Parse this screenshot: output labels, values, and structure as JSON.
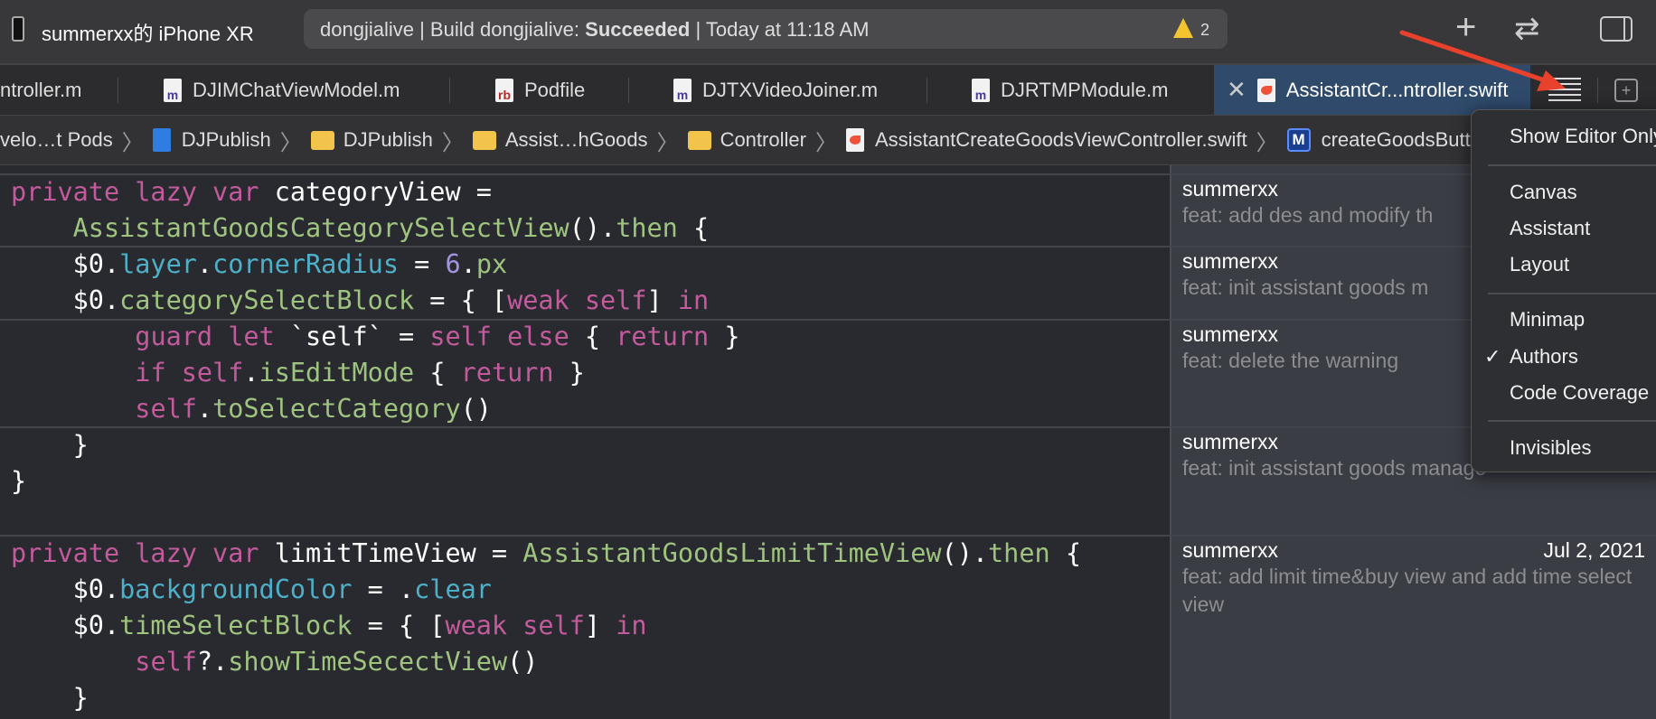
{
  "toolbar": {
    "device": "summerxx的 iPhone XR",
    "status_project": "dongjialive",
    "status_prefix": "Build dongjialive: ",
    "status_result": "Succeeded",
    "status_time": "Today at 11:18 AM",
    "warning_count": "2",
    "add_label": "+",
    "swap_label": "⇄"
  },
  "tabs": [
    {
      "label": "ntroller.m",
      "icon": "m"
    },
    {
      "label": "DJIMChatViewModel.m",
      "icon": "m"
    },
    {
      "label": "Podfile",
      "icon": "rb"
    },
    {
      "label": "DJTXVideoJoiner.m",
      "icon": "m"
    },
    {
      "label": "DJRTMPModule.m",
      "icon": "m"
    },
    {
      "label": "AssistantCr...ntroller.swift",
      "icon": "swift",
      "active": true
    }
  ],
  "breadcrumb": [
    "velo…t Pods",
    "DJPublish",
    "DJPublish",
    "Assist…hGoods",
    "Controller",
    "AssistantCreateGoodsViewController.swift",
    "createGoodsButto"
  ],
  "breadcrumb_method_icon": "M",
  "code": [
    [
      [
        "private lazy var ",
        "kw"
      ],
      [
        "categoryView =",
        "pl"
      ]
    ],
    [
      [
        "    ",
        "pl"
      ],
      [
        "AssistantGoodsCategorySelectView",
        "ty"
      ],
      [
        "().",
        "pl"
      ],
      [
        "then",
        "ty"
      ],
      [
        " {",
        "pl"
      ]
    ],
    [
      [
        "    $0.",
        "pl"
      ],
      [
        "layer",
        "pr"
      ],
      [
        ".",
        "pl"
      ],
      [
        "cornerRadius",
        "pr"
      ],
      [
        " = ",
        "pl"
      ],
      [
        "6",
        "nm"
      ],
      [
        ".",
        "pl"
      ],
      [
        "px",
        "ty"
      ]
    ],
    [
      [
        "    $0.",
        "pl"
      ],
      [
        "categorySelectBlock",
        "ty"
      ],
      [
        " = { [",
        "pl"
      ],
      [
        "weak self",
        "kw"
      ],
      [
        "] ",
        "pl"
      ],
      [
        "in",
        "kw"
      ]
    ],
    [
      [
        "        ",
        "pl"
      ],
      [
        "guard let",
        "kw"
      ],
      [
        " `self` = ",
        "pl"
      ],
      [
        "self else",
        "kw"
      ],
      [
        " { ",
        "pl"
      ],
      [
        "return",
        "kw"
      ],
      [
        " }",
        "pl"
      ]
    ],
    [
      [
        "        ",
        "pl"
      ],
      [
        "if self",
        "kw"
      ],
      [
        ".",
        "pl"
      ],
      [
        "isEditMode",
        "ty"
      ],
      [
        " { ",
        "pl"
      ],
      [
        "return",
        "kw"
      ],
      [
        " }",
        "pl"
      ]
    ],
    [
      [
        "        ",
        "pl"
      ],
      [
        "self",
        "kw"
      ],
      [
        ".",
        "pl"
      ],
      [
        "toSelectCategory",
        "ty"
      ],
      [
        "()",
        "pl"
      ]
    ],
    [
      [
        "    }",
        "pl"
      ]
    ],
    [
      [
        "}",
        "pl"
      ]
    ],
    [],
    [
      [
        "private lazy var ",
        "kw"
      ],
      [
        "limitTimeView = ",
        "pl"
      ],
      [
        "AssistantGoodsLimitTimeView",
        "ty"
      ],
      [
        "().",
        "pl"
      ],
      [
        "then",
        "ty"
      ],
      [
        " {",
        "pl"
      ]
    ],
    [
      [
        "    $0.",
        "pl"
      ],
      [
        "backgroundColor",
        "pr"
      ],
      [
        " = .",
        "pl"
      ],
      [
        "clear",
        "pr"
      ]
    ],
    [
      [
        "    $0.",
        "pl"
      ],
      [
        "timeSelectBlock",
        "ty"
      ],
      [
        " = { [",
        "pl"
      ],
      [
        "weak self",
        "kw"
      ],
      [
        "] ",
        "pl"
      ],
      [
        "in",
        "kw"
      ]
    ],
    [
      [
        "        ",
        "pl"
      ],
      [
        "self",
        "kw"
      ],
      [
        "?.",
        "pl"
      ],
      [
        "showTimeSecectView",
        "ty"
      ],
      [
        "()",
        "pl"
      ]
    ],
    [
      [
        "    }",
        "pl"
      ]
    ]
  ],
  "authors": [
    {
      "name": "summerxx",
      "message": "feat: add des and modify th",
      "date": ""
    },
    {
      "name": "summerxx",
      "message": "feat: init assistant goods m",
      "date": ""
    },
    {
      "name": "summerxx",
      "message": "feat: delete the warning",
      "date": ""
    },
    {
      "name": "summerxx",
      "message": "feat: init assistant goods manage",
      "date": ""
    },
    {
      "name": "summerxx",
      "message": "feat: add limit time&buy view and add time select view",
      "date": "Jul 2, 2021"
    }
  ],
  "menu": {
    "items": [
      {
        "label": "Show Editor Only",
        "checked": false
      },
      {
        "label": "Canvas",
        "checked": false
      },
      {
        "label": "Assistant",
        "checked": false
      },
      {
        "label": "Layout",
        "checked": false
      },
      {
        "label": "Minimap",
        "checked": false
      },
      {
        "label": "Authors",
        "checked": true
      },
      {
        "label": "Code Coverage",
        "checked": false
      },
      {
        "label": "Invisibles",
        "checked": false
      }
    ],
    "check_glyph": "✓"
  },
  "colors": {
    "keyword": "#c35a9c",
    "type": "#9fc47f",
    "property": "#4eb0c8",
    "number": "#a394e0",
    "active_tab": "#2f4a6b",
    "annotation_arrow": "#e8412c"
  }
}
